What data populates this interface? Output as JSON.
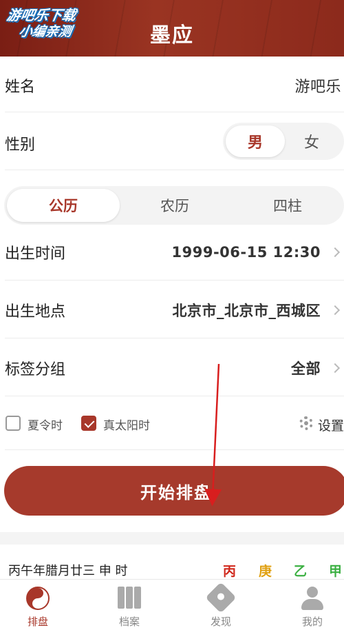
{
  "watermark": {
    "line1": "游吧乐下载",
    "line2": "小编亲测"
  },
  "header": {
    "title": "墨应"
  },
  "form": {
    "name_label": "姓名",
    "name_value": "游吧乐",
    "gender_label": "性别",
    "gender_options": [
      "男",
      "女"
    ],
    "gender_selected": "男",
    "calendar_tabs": [
      "公历",
      "农历",
      "四柱"
    ],
    "calendar_selected": "公历",
    "birth_time_label": "出生时间",
    "birth_time_value": "1999-06-15 12:30",
    "birth_place_label": "出生地点",
    "birth_place_value": "北京市_北京市_西城区",
    "tag_group_label": "标签分组",
    "tag_group_value": "全部",
    "dst_label": "夏令时",
    "dst_checked": false,
    "true_solar_label": "真太阳时",
    "true_solar_checked": true,
    "settings_label": "设置",
    "start_button": "开始排盘"
  },
  "info": {
    "lunar_text": "丙午年腊月廿三 申 时",
    "ganzhi": [
      {
        "char": "丙",
        "color": "#d0281c"
      },
      {
        "char": "庚",
        "color": "#e0a010"
      },
      {
        "char": "乙",
        "color": "#3cb043"
      },
      {
        "char": "甲",
        "color": "#3cb043"
      }
    ]
  },
  "tabbar": {
    "items": [
      {
        "label": "排盘",
        "icon": "yinyang-icon",
        "active": true
      },
      {
        "label": "档案",
        "icon": "books-icon",
        "active": false
      },
      {
        "label": "发现",
        "icon": "compass-icon",
        "active": false
      },
      {
        "label": "我的",
        "icon": "person-icon",
        "active": false
      }
    ],
    "active_color": "#a8372a"
  },
  "colors": {
    "brand": "#a63a2c",
    "header": "#8c2a1c"
  }
}
